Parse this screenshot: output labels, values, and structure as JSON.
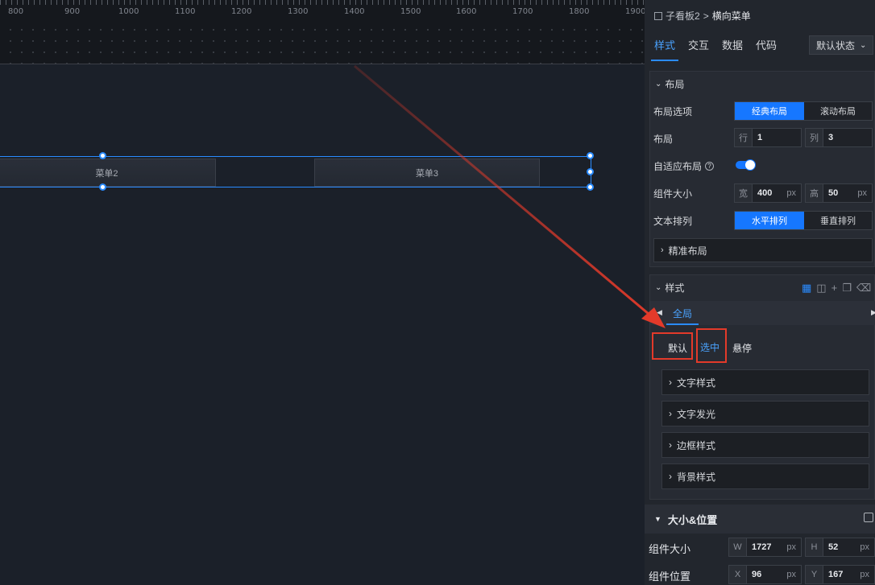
{
  "ruler": {
    "ticks": [
      "800",
      "900",
      "1000",
      "1100",
      "1200",
      "1300",
      "1400",
      "1500",
      "1600",
      "1700",
      "1800",
      "1900"
    ]
  },
  "canvas": {
    "menu_items": [
      "菜单2",
      "菜单3"
    ]
  },
  "breadcrumb": {
    "parent": "子看板2",
    "sep": ">",
    "current": "横向菜单"
  },
  "tabs": [
    "样式",
    "交互",
    "数据",
    "代码"
  ],
  "state_select": {
    "value": "默认状态"
  },
  "layout": {
    "title": "布局",
    "options_label": "布局选项",
    "options": [
      "经典布局",
      "滚动布局"
    ],
    "grid_label": "布局",
    "row_prefix": "行",
    "row_value": "1",
    "col_prefix": "列",
    "col_value": "3",
    "adaptive_label": "自适应布局",
    "size_label": "组件大小",
    "width_prefix": "宽",
    "width_value": "400",
    "width_unit": "px",
    "height_prefix": "高",
    "height_value": "50",
    "height_unit": "px",
    "text_label": "文本排列",
    "text_options": [
      "水平排列",
      "垂直排列"
    ],
    "precise": "精准布局"
  },
  "style": {
    "title": "样式",
    "scope_tab": "全局",
    "states": [
      "默认",
      "选中",
      "悬停"
    ],
    "groups": [
      "文字样式",
      "文字发光",
      "边框样式",
      "背景样式"
    ]
  },
  "size_pos": {
    "title": "大小&位置",
    "size_label": "组件大小",
    "w_prefix": "W",
    "w_value": "1727",
    "w_unit": "px",
    "h_prefix": "H",
    "h_value": "52",
    "h_unit": "px",
    "pos_label": "组件位置",
    "x_prefix": "X",
    "x_value": "96",
    "x_unit": "px",
    "y_prefix": "Y",
    "y_value": "167",
    "y_unit": "px"
  },
  "colors": {
    "accent": "#1677ff",
    "annotation": "#e33a2a"
  }
}
